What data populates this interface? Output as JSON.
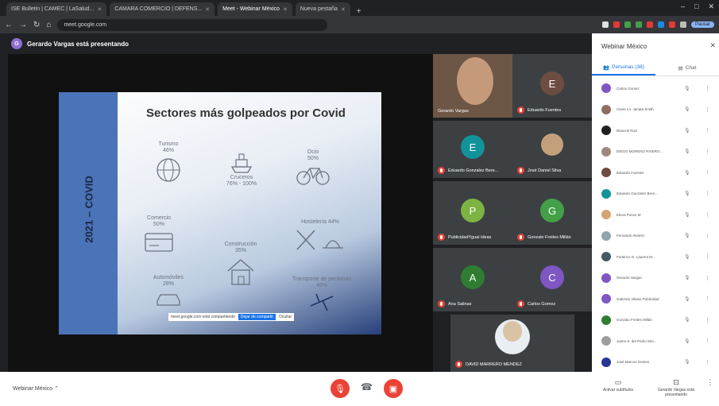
{
  "browser": {
    "tabs": [
      {
        "label": "ISE Bulletin | CAMEC | LaSalud..."
      },
      {
        "label": "CAMARA COMERCIO | DEFENS..."
      },
      {
        "label": "Meet - Webinar México"
      },
      {
        "label": "Nueva pestaña"
      }
    ],
    "url": "meet.google.com",
    "pause_label": "Pausar"
  },
  "meet": {
    "presenter_label": "Gerardo Vargas está presentando",
    "presenter_initial": "G",
    "meeting_name": "Webinar México",
    "controls": {
      "activate_captions": "Activar subtítulos",
      "presenting": "Gerardo Vargas está presentando"
    }
  },
  "slide": {
    "side_label": "2021 – COVID",
    "title": "Sectores más golpeados por Covid",
    "sectors": [
      {
        "label": "Turismo",
        "value": "46%",
        "icon": "globe-icon"
      },
      {
        "label": "Cruceros",
        "value": "76% - 100%",
        "icon": "ship-icon"
      },
      {
        "label": "Ocio",
        "value": "50%",
        "icon": "bicycle-icon"
      },
      {
        "label": "Comercio",
        "value": "50%",
        "icon": "credit-card-icon"
      },
      {
        "label": "Construcción",
        "value": "35%",
        "icon": "house-icon"
      },
      {
        "label": "Hostelería 44%",
        "value": "",
        "icon": "utensils-icon"
      },
      {
        "label": "Automóviles",
        "value": "28%",
        "icon": "car-icon"
      },
      {
        "label": "Transporte de personas",
        "value": "46%",
        "icon": "plane-icon"
      }
    ],
    "share_bar": {
      "text": "meet.google.com está compartiendo",
      "stop": "Dejar de compartir",
      "hide": "Ocultar"
    }
  },
  "participants_tiles": [
    {
      "name": "Gerardo Vargas",
      "initial": "",
      "color": "#7a5c4a"
    },
    {
      "name": "Eduardo Fuentes",
      "initial": "E",
      "color": "#6d4c41"
    },
    {
      "name": "Eduardo Gonzalez Bere...",
      "initial": "E",
      "color": "#12939a"
    },
    {
      "name": "José Daniel Silva",
      "initial": "",
      "color": "#c4a07a"
    },
    {
      "name": "PublicidadYgual Ideas",
      "initial": "P",
      "color": "#7cb342"
    },
    {
      "name": "Gonzalo Freites Millán",
      "initial": "G",
      "color": "#43a047"
    },
    {
      "name": "Ana Salinas",
      "initial": "A",
      "color": "#2e7d32"
    },
    {
      "name": "Carlos Gomez",
      "initial": "C",
      "color": "#7e57c2"
    },
    {
      "name": "DAVID MARRERO MENDEZ",
      "initial": "",
      "color": "#d9c3a5"
    }
  ],
  "panel": {
    "title": "Webinar México",
    "tab_people": "Personas (38)",
    "tab_chat": "Chat",
    "people": [
      {
        "name": "Carlos Gomez",
        "color": "#7e57c2"
      },
      {
        "name": "Claire Lo. Janata Smith",
        "color": "#8d6e63"
      },
      {
        "name": "Diana B Ruiz",
        "color": "#212121"
      },
      {
        "name": "DIEGO MORENO RIVERO...",
        "color": "#a1887f"
      },
      {
        "name": "Eduardo Fuentes",
        "color": "#6d4c41"
      },
      {
        "name": "Eduardo Gonzalez Bere...",
        "color": "#12939a"
      },
      {
        "name": "Elena Ponce M",
        "color": "#d4a373"
      },
      {
        "name": "Fernando Alvarez",
        "color": "#90a4ae"
      },
      {
        "name": "Federico G. Laurent M...",
        "color": "#455a64"
      },
      {
        "name": "Gerardo Vargas",
        "color": "#7e57c2"
      },
      {
        "name": "Gabriela Vilanis Publicidad",
        "color": "#7e57c2"
      },
      {
        "name": "Gonzalo Freites Millán",
        "color": "#2e7d32"
      },
      {
        "name": "Jaime S. del Pedro Mor...",
        "color": "#9e9e9e"
      },
      {
        "name": "José Marcos Gentes",
        "color": "#283593"
      }
    ]
  }
}
